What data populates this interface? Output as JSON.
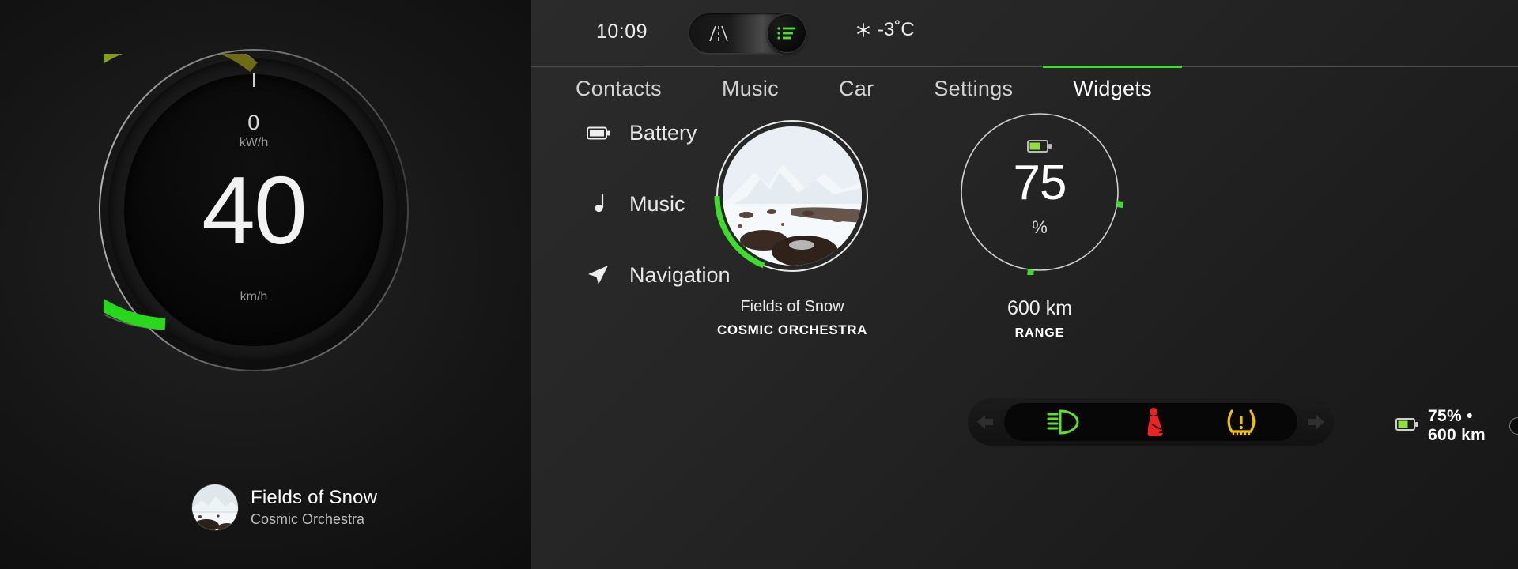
{
  "cluster": {
    "gauge": {
      "power_value": "0",
      "power_unit": "kW/h",
      "speed_value": "40",
      "speed_unit": "km/h",
      "arc_percent": 62,
      "arc_color_start": "#6f6b14",
      "arc_color_end": "#2fd81f"
    },
    "now_playing": {
      "title": "Fields of Snow",
      "artist": "Cosmic Orchestra",
      "art_name": "album-art-snowy-mountains"
    }
  },
  "headunit": {
    "topbar": {
      "clock": "10:09",
      "mode_toggle": {
        "left_icon": "road-perspective-icon",
        "right_icon": "list-lines-icon",
        "active": "list"
      },
      "weather": {
        "icon": "snowflake-icon",
        "temperature": "-3˚C"
      }
    },
    "tabs": [
      {
        "label": "Contacts",
        "active": false
      },
      {
        "label": "Music",
        "active": false
      },
      {
        "label": "Car",
        "active": false
      },
      {
        "label": "Settings",
        "active": false
      },
      {
        "label": "Widgets",
        "active": true
      }
    ],
    "widget_menu": [
      {
        "label": "Battery",
        "icon": "battery-icon"
      },
      {
        "label": "Music",
        "icon": "music-note-icon"
      },
      {
        "label": "Navigation",
        "icon": "navigation-arrow-icon"
      }
    ],
    "music_widget": {
      "title": "Fields of Snow",
      "artist": "COSMIC ORCHESTRA",
      "progress_percent": 31,
      "progress_color": "#3ddc2d"
    },
    "battery_widget": {
      "value": "75",
      "unit": "%",
      "range": "600 km",
      "range_label": "RANGE",
      "percent": 75,
      "ring_color": "#3ddc2d",
      "icon": "battery-three-quarters-icon"
    }
  },
  "statusbar": {
    "telltales": [
      {
        "name": "high-beam-icon",
        "color": "#5fe22a"
      },
      {
        "name": "seatbelt-warning-icon",
        "color": "#ee2222"
      },
      {
        "name": "tire-pressure-warning-icon",
        "color": "#f2c200"
      }
    ],
    "turn_left_icon": "turn-signal-left-icon",
    "turn_right_icon": "turn-signal-right-icon",
    "battery": {
      "icon": "battery-three-quarters-icon",
      "text": "75% • 600 km",
      "percent": 75,
      "fill_color": "#45e024"
    }
  }
}
